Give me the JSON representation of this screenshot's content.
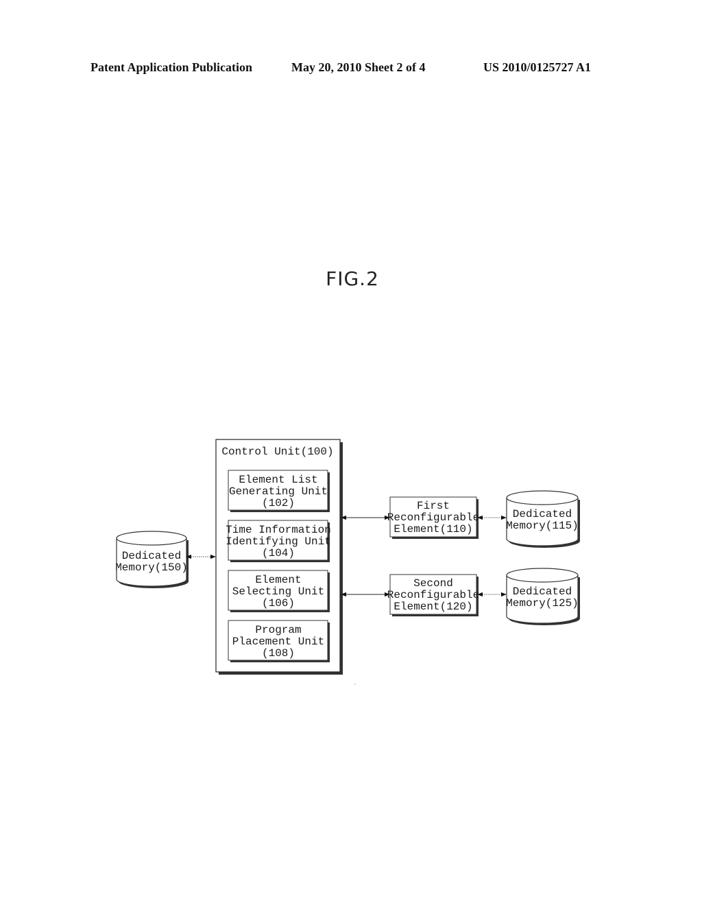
{
  "header": {
    "publication": "Patent Application Publication",
    "date_sheet": "May 20, 2010  Sheet 2 of 4",
    "patent_number": "US 2010/0125727 A1"
  },
  "figure": {
    "title": "FIG.2"
  },
  "diagram": {
    "control_unit": {
      "label": "Control Unit(100)",
      "sub_units": [
        {
          "lines": [
            "Element List",
            "Generating Unit",
            "(102)"
          ]
        },
        {
          "lines": [
            "Time Information",
            "Identifying Unit",
            "(104)"
          ]
        },
        {
          "lines": [
            "Element",
            "Selecting Unit",
            "(106)"
          ]
        },
        {
          "lines": [
            "Program",
            "Placement Unit",
            "(108)"
          ]
        }
      ]
    },
    "left_memory": {
      "lines": [
        "Dedicated",
        "Memory(150)"
      ]
    },
    "elements": [
      {
        "lines": [
          "First",
          "Reconfigurable",
          "Element(110)"
        ]
      },
      {
        "lines": [
          "Second",
          "Reconfigurable",
          "Element(120)"
        ]
      }
    ],
    "right_memories": [
      {
        "lines": [
          "Dedicated",
          "Memory(115)"
        ]
      },
      {
        "lines": [
          "Dedicated",
          "Memory(125)"
        ]
      }
    ]
  }
}
